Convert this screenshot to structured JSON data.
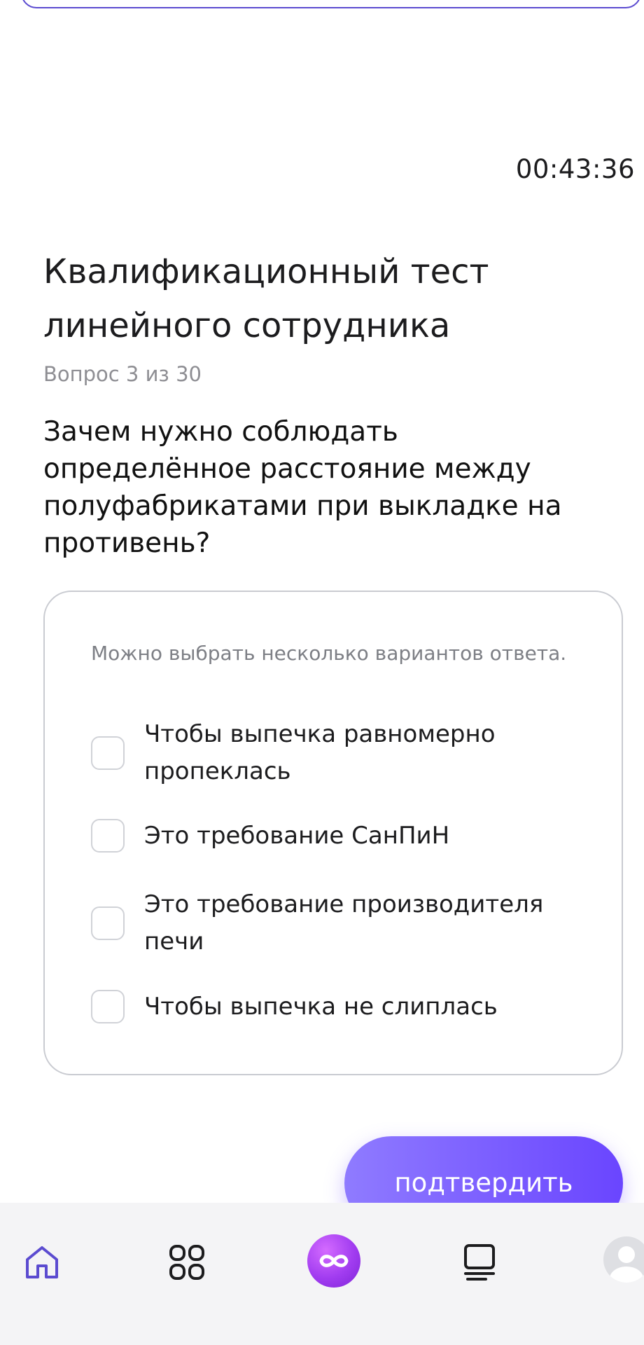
{
  "quiz": {
    "timer": "00:43:36",
    "title": "Квалификационный тест линейного сотрудника",
    "progress": "Вопрос 3 из 30",
    "question": "Зачем нужно соблюдать определённое расстояние между полуфабрикатами при выкладке на противень?",
    "hint": "Можно выбрать несколько вариантов ответа.",
    "options": [
      {
        "label": "Чтобы выпечка равномерно пропеклась",
        "checked": false
      },
      {
        "label": "Это требование СанПиН",
        "checked": false
      },
      {
        "label": "Это требование производителя печи",
        "checked": false
      },
      {
        "label": "Чтобы выпечка не слиплась",
        "checked": false
      }
    ],
    "confirm_label": "подтвердить"
  },
  "nav": {
    "items": [
      {
        "icon": "home-icon",
        "active": true
      },
      {
        "icon": "grid-icon",
        "active": false
      },
      {
        "icon": "infinity-icon",
        "active": false
      },
      {
        "icon": "courses-icon",
        "active": false
      },
      {
        "icon": "avatar-icon",
        "active": false
      }
    ]
  },
  "colors": {
    "accent": "#6a45ff",
    "accent_light": "#8f7bff",
    "nav_active": "#5b4bd0",
    "card_border": "#c9cbd1",
    "muted_text": "#8e8e93"
  }
}
